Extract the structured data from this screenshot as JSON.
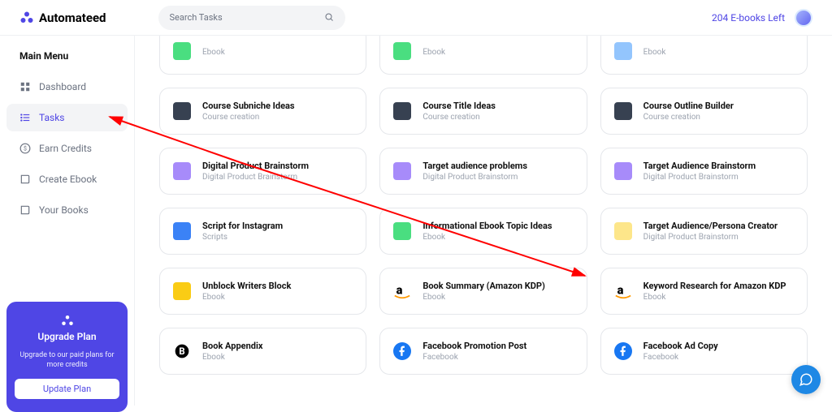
{
  "brand": "Automateed",
  "search": {
    "placeholder": "Search Tasks"
  },
  "ebooks_left": "204 E-books Left",
  "sidebar": {
    "title": "Main Menu",
    "items": [
      {
        "label": "Dashboard"
      },
      {
        "label": "Tasks"
      },
      {
        "label": "Earn Credits"
      },
      {
        "label": "Create Ebook"
      },
      {
        "label": "Your Books"
      }
    ]
  },
  "upgrade": {
    "title": "Upgrade Plan",
    "sub": "Upgrade to our paid plans for more credits",
    "button": "Update Plan"
  },
  "cards": [
    {
      "title": "",
      "sub": "Ebook"
    },
    {
      "title": "",
      "sub": "Ebook"
    },
    {
      "title": "",
      "sub": "Ebook"
    },
    {
      "title": "Course Subniche Ideas",
      "sub": "Course creation"
    },
    {
      "title": "Course Title Ideas",
      "sub": "Course creation"
    },
    {
      "title": "Course Outline Builder",
      "sub": "Course creation"
    },
    {
      "title": "Digital Product Brainstorm",
      "sub": "Digital Product Brainstorm"
    },
    {
      "title": "Target audience problems",
      "sub": "Digital Product Brainstorm"
    },
    {
      "title": "Target Audience Brainstorm",
      "sub": "Digital Product Brainstorm"
    },
    {
      "title": "Script for Instagram",
      "sub": "Scripts"
    },
    {
      "title": "Informational Ebook Topic Ideas",
      "sub": "Ebook"
    },
    {
      "title": "Target Audience/Persona Creator",
      "sub": "Digital Product Brainstorm"
    },
    {
      "title": "Unblock Writers Block",
      "sub": "Ebook"
    },
    {
      "title": "Book Summary (Amazon KDP)",
      "sub": "Ebook"
    },
    {
      "title": "Keyword Research for Amazon KDP",
      "sub": "Ebook"
    },
    {
      "title": "Book Appendix",
      "sub": "Ebook"
    },
    {
      "title": "Facebook Promotion Post",
      "sub": "Facebook"
    },
    {
      "title": "Facebook Ad Copy",
      "sub": "Facebook"
    }
  ]
}
